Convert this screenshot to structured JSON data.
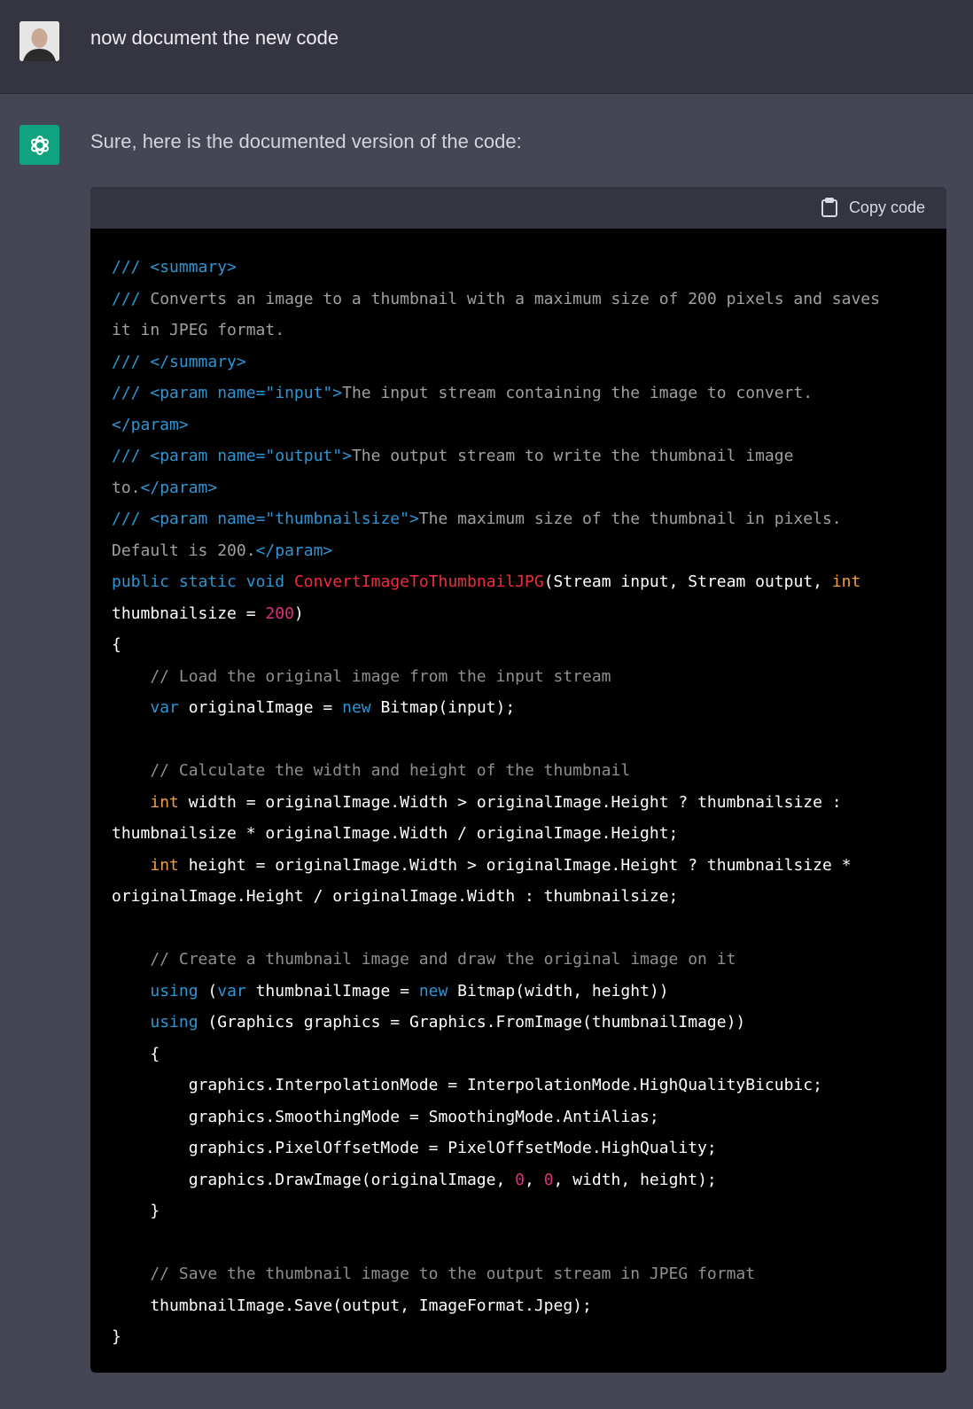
{
  "user_message": {
    "avatar": "user-avatar-photo",
    "text": "now document the new code"
  },
  "assistant_message": {
    "logo": "openai-logo-icon",
    "intro": "Sure, here is the documented version of the code:",
    "code_block": {
      "copy_label": "Copy code",
      "copy_icon": "clipboard-icon",
      "lines": [
        "/// <summary>",
        "/// Converts an image to a thumbnail with a maximum size of 200 pixels and saves",
        "it in JPEG format.",
        "/// </summary>",
        "/// <param name=\"input\">The input stream containing the image to convert.",
        "</param>",
        "/// <param name=\"output\">The output stream to write the thumbnail image",
        "to.</param>",
        "/// <param name=\"thumbnailsize\">The maximum size of the thumbnail in pixels.",
        "Default is 200.</param>",
        "public static void ConvertImageToThumbnailJPG(Stream input, Stream output, int",
        "thumbnailsize = 200)",
        "{",
        "    // Load the original image from the input stream",
        "    var originalImage = new Bitmap(input);",
        "",
        "    // Calculate the width and height of the thumbnail",
        "    int width = originalImage.Width > originalImage.Height ? thumbnailsize :",
        "thumbnailsize * originalImage.Width / originalImage.Height;",
        "    int height = originalImage.Width > originalImage.Height ? thumbnailsize *",
        "originalImage.Height / originalImage.Width : thumbnailsize;",
        "",
        "    // Create a thumbnail image and draw the original image on it",
        "    using (var thumbnailImage = new Bitmap(width, height))",
        "    using (Graphics graphics = Graphics.FromImage(thumbnailImage))",
        "    {",
        "        graphics.InterpolationMode = InterpolationMode.HighQualityBicubic;",
        "        graphics.SmoothingMode = SmoothingMode.AntiAlias;",
        "        graphics.PixelOffsetMode = PixelOffsetMode.HighQuality;",
        "        graphics.DrawImage(originalImage, 0, 0, width, height);",
        "    }",
        "",
        "    // Save the thumbnail image to the output stream in JPEG format",
        "    thumbnailImage.Save(output, ImageFormat.Jpeg);",
        "}"
      ]
    }
  }
}
